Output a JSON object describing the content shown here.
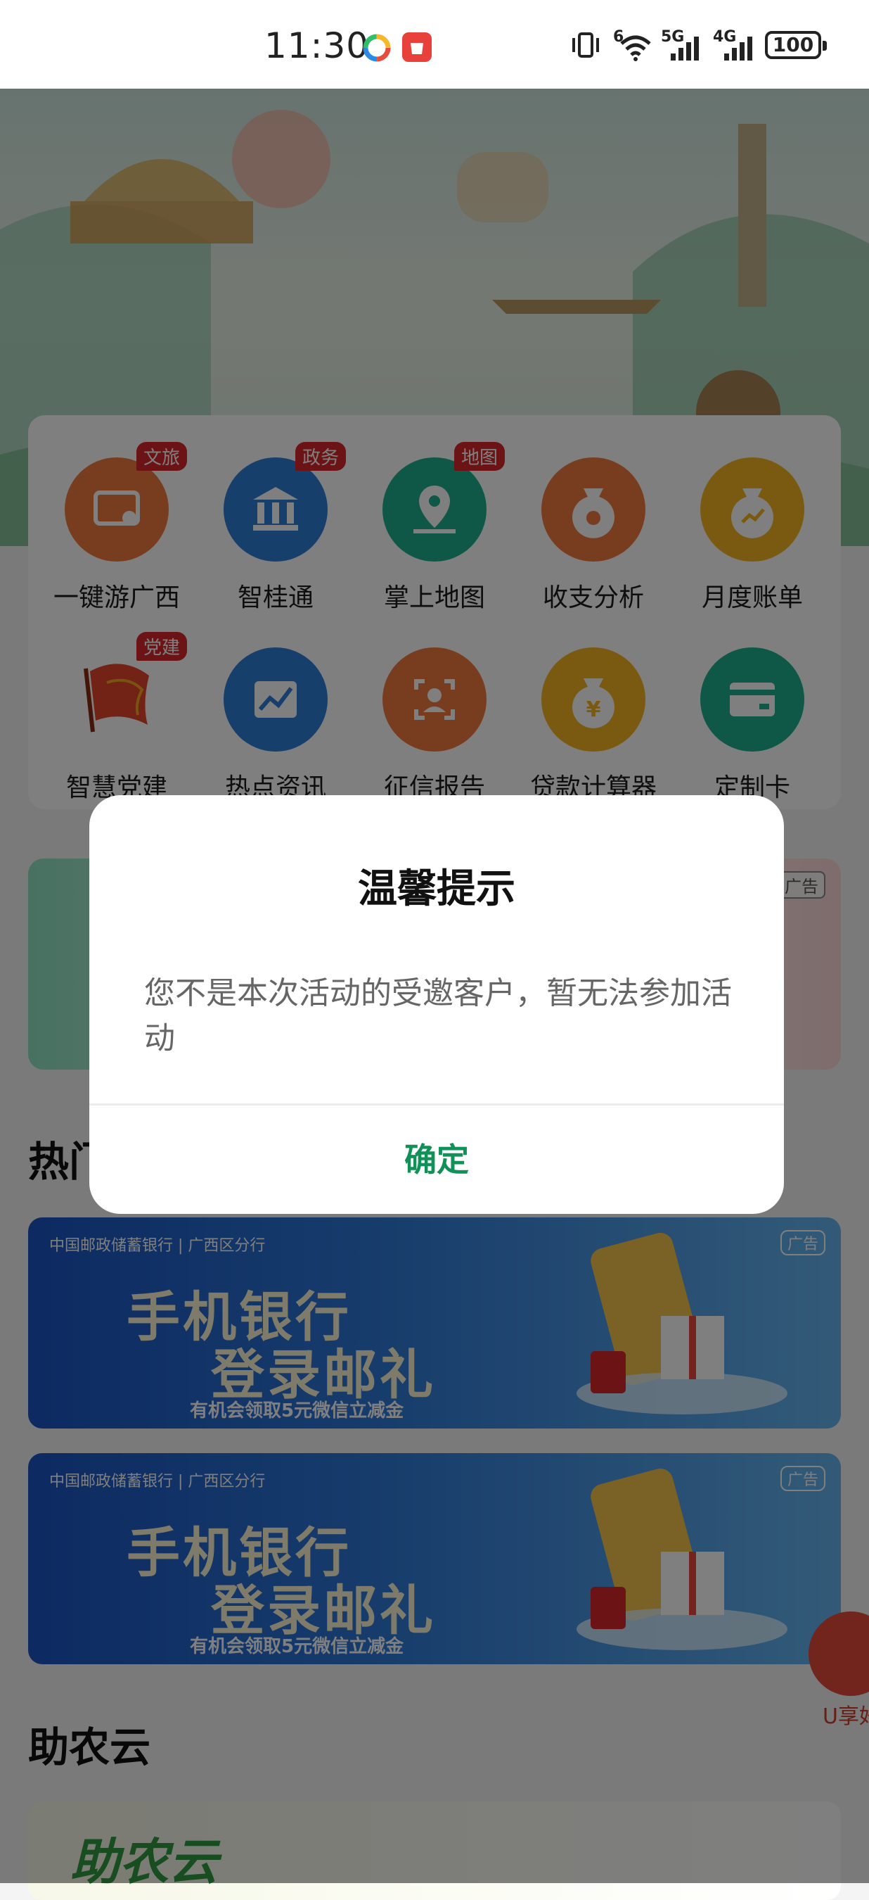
{
  "status_bar": {
    "time": "11:30",
    "wifi_label": "6",
    "signal1_label": "5G",
    "signal2_label": "4G",
    "battery": "100"
  },
  "services": [
    {
      "label": "一键游广西",
      "tag": "文旅",
      "icon": "travel-card-icon",
      "color": "#f07b3c"
    },
    {
      "label": "智桂通",
      "tag": "政务",
      "icon": "government-building-icon",
      "color": "#2f7fd8"
    },
    {
      "label": "掌上地图",
      "tag": "地图",
      "icon": "map-pin-icon",
      "color": "#1fae8d"
    },
    {
      "label": "收支分析",
      "tag": "",
      "icon": "money-bag-icon",
      "color": "#f07b3c"
    },
    {
      "label": "月度账单",
      "tag": "",
      "icon": "bill-chart-icon",
      "color": "#f3b520"
    },
    {
      "label": "智慧党建",
      "tag": "党建",
      "icon": "red-flag-icon",
      "color": "#e4472b"
    },
    {
      "label": "热点资讯",
      "tag": "",
      "icon": "trend-chart-icon",
      "color": "#2f7fd8"
    },
    {
      "label": "征信报告",
      "tag": "",
      "icon": "face-scan-icon",
      "color": "#f07b3c"
    },
    {
      "label": "贷款计算器",
      "tag": "",
      "icon": "yuan-bag-icon",
      "color": "#f3b520"
    },
    {
      "label": "定制卡",
      "tag": "",
      "icon": "card-icon",
      "color": "#1fae8d"
    }
  ],
  "ad_strip": {
    "tag": "广告"
  },
  "hot_section": {
    "title": "热门活动"
  },
  "banners": [
    {
      "bank": "中国邮政储蓄银行 | 广西区分行",
      "line1": "手机银行",
      "line2": "登录邮礼",
      "sub": "有机会领取5元微信立减金",
      "badge": "广告"
    },
    {
      "bank": "中国邮政储蓄银行 | 广西区分行",
      "line1": "手机银行",
      "line2": "登录邮礼",
      "sub": "有机会领取5元微信立减金",
      "badge": "广告"
    }
  ],
  "floating": {
    "label": "U享好"
  },
  "zhunong_section": {
    "title": "助农云",
    "card_text": "助农云"
  },
  "dialog": {
    "title": "温馨提示",
    "message": "您不是本次活动的受邀客户，暂无法参加活动",
    "confirm": "确定"
  },
  "colors": {
    "accent_green": "#0f9157",
    "tag_red": "#d9262c"
  }
}
